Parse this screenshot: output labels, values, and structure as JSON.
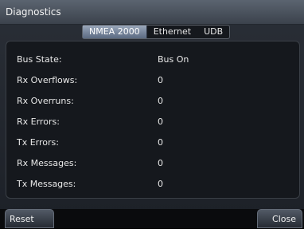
{
  "window": {
    "title": "Diagnostics"
  },
  "tabs": [
    {
      "label": "NMEA 2000",
      "active": true
    },
    {
      "label": "Ethernet",
      "active": false
    },
    {
      "label": "UDB",
      "active": false
    }
  ],
  "diagnostics": [
    {
      "label": "Bus State:",
      "value": "Bus On"
    },
    {
      "label": "Rx Overflows:",
      "value": "0"
    },
    {
      "label": "Rx Overruns:",
      "value": "0"
    },
    {
      "label": "Rx Errors:",
      "value": "0"
    },
    {
      "label": "Tx Errors:",
      "value": "0"
    },
    {
      "label": "Rx Messages:",
      "value": "0"
    },
    {
      "label": "Tx Messages:",
      "value": "0"
    }
  ],
  "buttons": {
    "reset": "Reset",
    "close": "Close"
  }
}
